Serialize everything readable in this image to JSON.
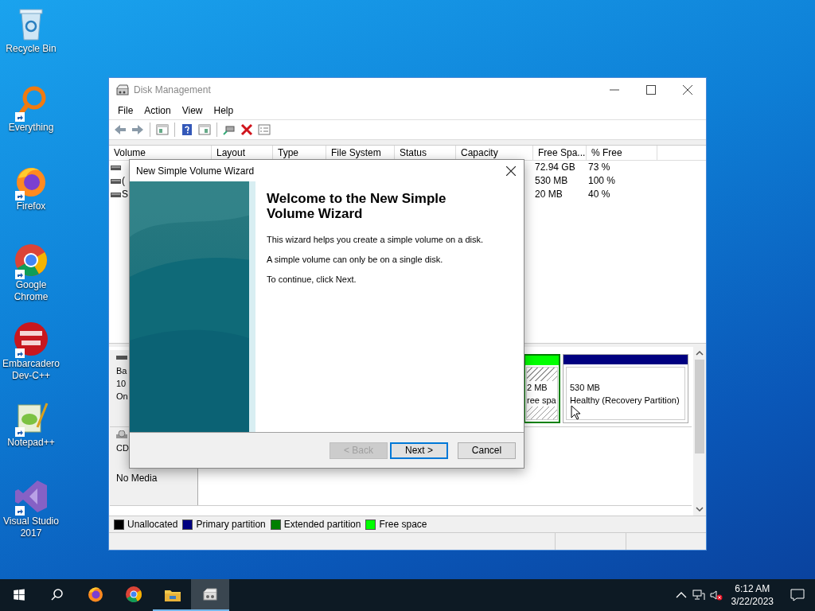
{
  "desktop_icons": [
    {
      "label": "Recycle Bin",
      "kind": "recycle",
      "shortcut": false
    },
    {
      "label": "Everything",
      "kind": "magnifier",
      "shortcut": true
    },
    {
      "label": "Firefox",
      "kind": "firefox",
      "shortcut": true
    },
    {
      "label": "Google Chrome",
      "kind": "chrome",
      "shortcut": true
    },
    {
      "label": "Embarcadero Dev-C++",
      "kind": "devcpp",
      "shortcut": true
    },
    {
      "label": "Notepad++",
      "kind": "notepad",
      "shortcut": true
    },
    {
      "label": "Visual Studio 2017",
      "kind": "vs",
      "shortcut": true
    }
  ],
  "window": {
    "title": "Disk Management",
    "menu": [
      "File",
      "Action",
      "View",
      "Help"
    ],
    "toolbar": [
      {
        "kind": "back"
      },
      {
        "kind": "forward"
      },
      {
        "kind": "sep"
      },
      {
        "kind": "panel"
      },
      {
        "kind": "sep"
      },
      {
        "kind": "help"
      },
      {
        "kind": "panel2"
      },
      {
        "kind": "sep"
      },
      {
        "kind": "connect"
      },
      {
        "kind": "delete"
      },
      {
        "kind": "properties"
      }
    ],
    "columns": [
      "Volume",
      "Layout",
      "Type",
      "File System",
      "Status",
      "Capacity",
      "Free Spa...",
      "% Free"
    ],
    "volumes": [
      {
        "free_space": "72.94 GB",
        "percent_free": "73 %"
      },
      {
        "volume": "(",
        "free_space": "530 MB",
        "percent_free": "100 %"
      },
      {
        "volume": "S",
        "free_space": "20 MB",
        "percent_free": "40 %"
      }
    ],
    "disks": [
      {
        "kind": "disk",
        "lines": [
          "Ba",
          "10",
          "On"
        ],
        "partitions": [
          {
            "kind": "free",
            "lines": [
              "2 MB",
              "ree spa"
            ]
          },
          {
            "kind": "primary",
            "lines": [
              "530 MB",
              "Healthy (Recovery Partition)"
            ]
          }
        ]
      },
      {
        "kind": "cdrom",
        "lines": [
          "CD",
          "No Media"
        ]
      }
    ],
    "legend": [
      {
        "label": "Unallocated",
        "color": "#000000"
      },
      {
        "label": "Primary partition",
        "color": "#000080"
      },
      {
        "label": "Extended partition",
        "color": "#008000"
      },
      {
        "label": "Free space",
        "color": "#00ff00"
      }
    ]
  },
  "wizard": {
    "title": "New Simple Volume Wizard",
    "heading": "Welcome to the New Simple Volume Wizard",
    "paragraphs": [
      "This wizard helps you create a simple volume on a disk.",
      "A simple volume can only be on a single disk.",
      "To continue, click Next."
    ],
    "buttons": [
      {
        "label": "< Back",
        "disabled": true,
        "default": false
      },
      {
        "label": "Next >",
        "disabled": false,
        "default": true
      },
      {
        "label": "Cancel",
        "disabled": false,
        "default": false
      }
    ]
  },
  "taskbar": {
    "apps": [
      {
        "kind": "firefox",
        "running": false,
        "selected": false
      },
      {
        "kind": "chrome",
        "running": false,
        "selected": false
      },
      {
        "kind": "explorer",
        "running": true,
        "selected": false
      },
      {
        "kind": "diskmgmt",
        "running": true,
        "selected": true
      }
    ],
    "time": "6:12 AM",
    "date": "3/22/2023"
  }
}
